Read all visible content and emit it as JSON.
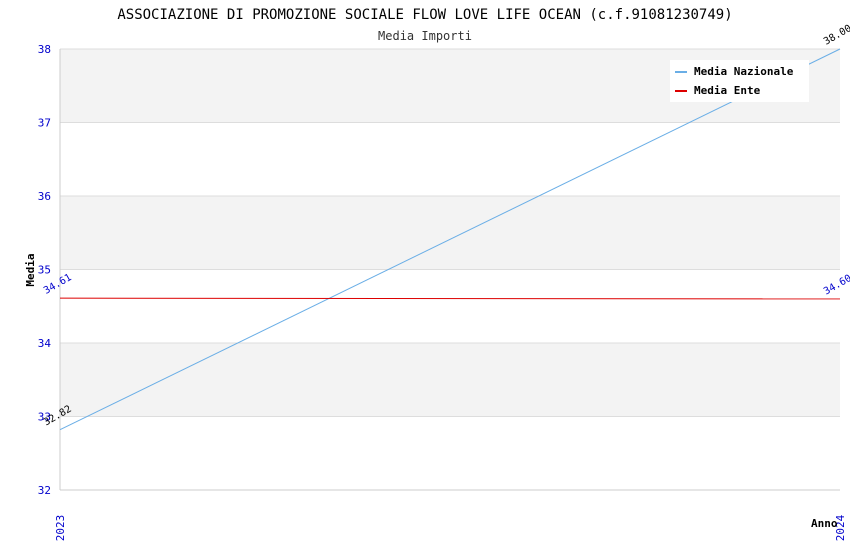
{
  "chart_data": {
    "type": "line",
    "title": "ASSOCIAZIONE DI PROMOZIONE SOCIALE FLOW LOVE LIFE OCEAN (c.f.91081230749)",
    "subtitle": "Media Importi",
    "xlabel": "Anno",
    "ylabel": "Media",
    "categories": [
      "2023",
      "2024"
    ],
    "ylim": [
      32,
      38
    ],
    "yticks": [
      "32",
      "33",
      "34",
      "35",
      "36",
      "37",
      "38"
    ],
    "grid": true,
    "legend_position": "top-right",
    "series": [
      {
        "name": "Media Nazionale",
        "color": "#6aaee6",
        "values": [
          32.82,
          38.0
        ],
        "labels": [
          "32.82",
          "38.00"
        ]
      },
      {
        "name": "Media Ente",
        "color": "#dd0000",
        "values": [
          34.61,
          34.6
        ],
        "labels": [
          "34.61",
          "34.60"
        ]
      }
    ]
  }
}
